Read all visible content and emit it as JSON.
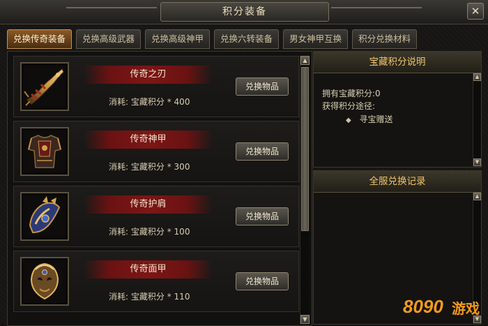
{
  "window": {
    "title": "积分装备",
    "close_glyph": "✕"
  },
  "tabs": [
    {
      "label": "兑换传奇装备",
      "active": true
    },
    {
      "label": "兑换高级武器",
      "active": false
    },
    {
      "label": "兑换高级神甲",
      "active": false
    },
    {
      "label": "兑换六转装备",
      "active": false
    },
    {
      "label": "男女神甲互换",
      "active": false
    },
    {
      "label": "积分兑换材料",
      "active": false
    }
  ],
  "items": [
    {
      "name": "传奇之刃",
      "cost_label": "消耗:",
      "currency": "宝藏积分",
      "multiplier": "*",
      "amount": "400",
      "button": "兑换物品",
      "icon": "sword-icon"
    },
    {
      "name": "传奇神甲",
      "cost_label": "消耗:",
      "currency": "宝藏积分",
      "multiplier": "*",
      "amount": "300",
      "button": "兑换物品",
      "icon": "armor-icon"
    },
    {
      "name": "传奇护肩",
      "cost_label": "消耗:",
      "currency": "宝藏积分",
      "multiplier": "*",
      "amount": "100",
      "button": "兑换物品",
      "icon": "pauldron-icon"
    },
    {
      "name": "传奇面甲",
      "cost_label": "消耗:",
      "currency": "宝藏积分",
      "multiplier": "*",
      "amount": "110",
      "button": "兑换物品",
      "icon": "mask-icon"
    }
  ],
  "info_panel": {
    "title": "宝藏积分说明",
    "owned_label": "拥有宝藏积分:",
    "owned_value": "0",
    "source_label": "获得积分途径:",
    "sources": [
      "寻宝赠送"
    ]
  },
  "record_panel": {
    "title": "全服兑换记录"
  },
  "watermark": {
    "number": "8090",
    "text": "游戏"
  },
  "colors": {
    "accent": "#f0c46a",
    "active_tab": "#8a5a26",
    "name_plate": "#7c1616",
    "watermark": "#f39a1e"
  }
}
